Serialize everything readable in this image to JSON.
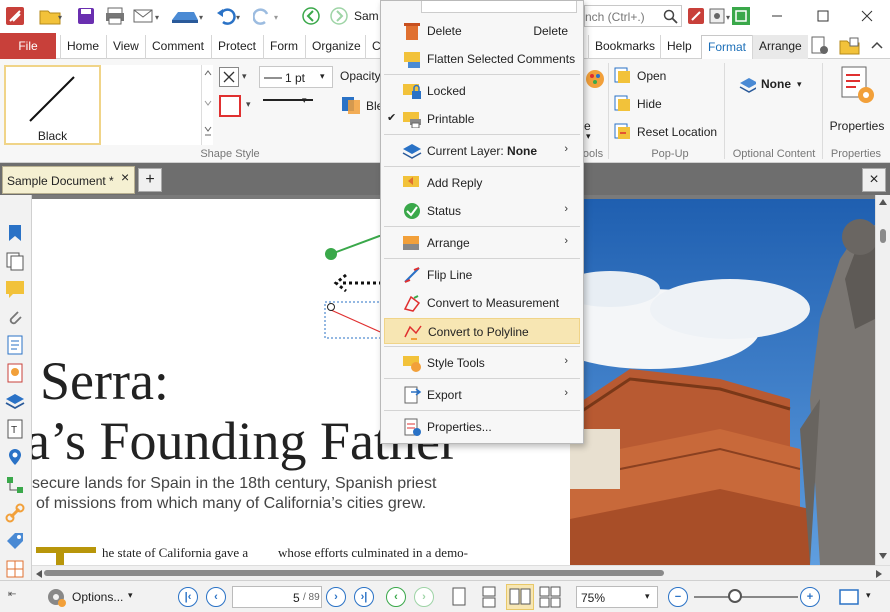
{
  "titlebar": {
    "doc_title_fragment": "Sam",
    "search_placeholder": "nch (Ctrl+.)"
  },
  "tabs": [
    {
      "label": "File"
    },
    {
      "label": "Home"
    },
    {
      "label": "View"
    },
    {
      "label": "Comment"
    },
    {
      "label": "Protect"
    },
    {
      "label": "Form"
    },
    {
      "label": "Organize"
    },
    {
      "label": "C"
    },
    {
      "label": "Bookmarks"
    },
    {
      "label": "Help"
    },
    {
      "label": "Format"
    },
    {
      "label": "Arrange"
    }
  ],
  "ribbon": {
    "style_preset_label": "Black",
    "shape_style_group": "Shape Style",
    "line_width": "1 pt",
    "opacity_label": "Opacity",
    "blend_fragment": "Ble",
    "popup_open": "Open",
    "popup_hide": "Hide",
    "popup_reset": "Reset Location",
    "popup_group": "Pop-Up",
    "tools_group_fragment": "ools",
    "e_fragment": "e",
    "layer_value": "None",
    "optional_content_group": "Optional Content",
    "properties_label": "Properties",
    "properties_group": "Properties"
  },
  "doc_tab": {
    "title": "Sample Document *",
    "close": "×",
    "new_tab": "+",
    "close_all": "×"
  },
  "document": {
    "heading_line1": "Serra:",
    "heading_line2": "a’s Founding Father",
    "subhead_line1": "secure lands for Spain in the 18th century, Spanish priest",
    "subhead_line2": "of missions from which many of California’s cities grew.",
    "body_start": "he state of California gave a",
    "body_continue": "whose efforts culminated in a demo-"
  },
  "context_menu": {
    "items": [
      {
        "label": "Delete",
        "shortcut": "Delete",
        "icon": "trash-icon"
      },
      {
        "label": "Flatten Selected Comments",
        "icon": "flatten-icon"
      },
      {
        "label": "Locked",
        "icon": "lock-icon"
      },
      {
        "label": "Printable",
        "checked_mark": "✔",
        "icon": "printer-icon"
      },
      {
        "label_prefix": "Current Layer: ",
        "label_value": "None",
        "icon": "layer-icon",
        "arrow": "›"
      },
      {
        "label": "Add Reply",
        "icon": "reply-icon"
      },
      {
        "label": "Status",
        "icon": "status-check-icon",
        "arrow": "›"
      },
      {
        "label": "Arrange",
        "icon": "arrange-icon",
        "arrow": "›"
      },
      {
        "label": "Flip Line",
        "icon": "flip-line-icon"
      },
      {
        "label": "Convert to Measurement",
        "icon": "measurement-icon"
      },
      {
        "label": "Convert to Polyline",
        "icon": "polyline-icon"
      },
      {
        "label": "Style Tools",
        "icon": "style-tools-icon",
        "arrow": "›"
      },
      {
        "label": "Export",
        "icon": "export-icon",
        "arrow": "›"
      },
      {
        "label": "Properties...",
        "icon": "properties-icon"
      }
    ]
  },
  "statusbar": {
    "options_label": "Options...",
    "page_current": "5",
    "page_total": "/ 89",
    "zoom": "75%"
  },
  "colors": {
    "file_tab": "#c8403a",
    "accent_blue": "#1c6fb8",
    "menu_highlight": "#f7e6b3",
    "annotation_red": "#e03030",
    "line_green": "#3aa84a"
  }
}
